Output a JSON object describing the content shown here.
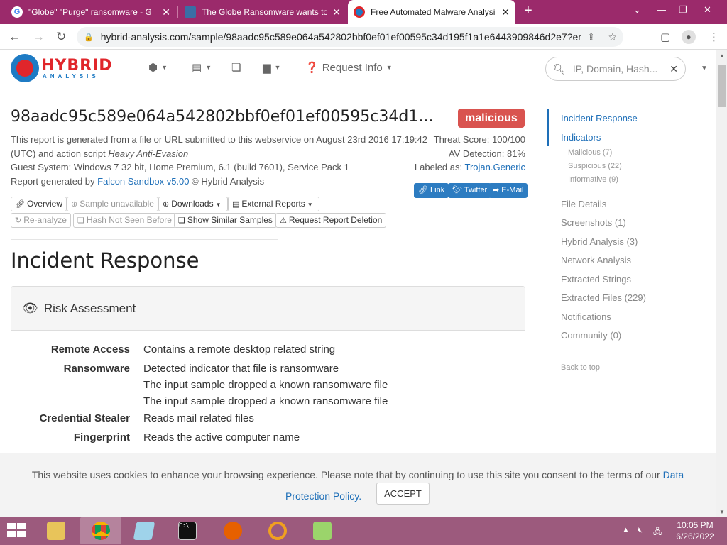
{
  "browser": {
    "tabs": [
      {
        "title": "\"Globe\" \"Purge\" ransomware - G",
        "active": false
      },
      {
        "title": "The Globe Ransomware wants to",
        "active": false
      },
      {
        "title": "Free Automated Malware Analysi",
        "active": true
      }
    ],
    "url": "hybrid-analysis.com/sample/98aadc95c589e064a542802bbf0ef01ef00595c34d195f1a1e6443909846d2e7?enviro..."
  },
  "header": {
    "logo_text": "HYBRID",
    "logo_sub": "ANALYSIS",
    "request_info": "Request Info",
    "search_placeholder": "IP, Domain, Hash..."
  },
  "report": {
    "hash": "98aadc95c589e064a542802bbf0ef01ef00595c34d1...",
    "verdict": "malicious",
    "line1": "This report is generated from a file or URL submitted to this webservice on August 23rd 2016 17:19:42",
    "line2_prefix": "(UTC) and action script ",
    "line2_script": "Heavy Anti-Evasion",
    "line3": "Guest System: Windows 7 32 bit, Home Premium, 6.1 (build 7601), Service Pack 1",
    "line4_prefix": "Report generated by ",
    "line4_link": "Falcon Sandbox v5.00",
    "line4_suffix": " © Hybrid Analysis",
    "threat_score": "Threat Score: 100/100",
    "av_detection": "AV Detection: 81%",
    "labeled_prefix": "Labeled as: ",
    "labeled_link": "Trojan.Generic"
  },
  "share": {
    "link": "Link",
    "twitter": "Twitter",
    "email": "E-Mail"
  },
  "actions": {
    "overview": "Overview",
    "sample_unavailable": "Sample unavailable",
    "downloads": "Downloads",
    "external_reports": "External Reports",
    "reanalyze": "Re-analyze",
    "hash_not_seen": "Hash Not Seen Before",
    "similar_samples": "Show Similar Samples",
    "request_deletion": "Request Report Deletion"
  },
  "section_title": "Incident Response",
  "risk": {
    "title": "Risk Assessment",
    "rows": [
      {
        "category": "Remote Access",
        "items": [
          "Contains a remote desktop related string"
        ]
      },
      {
        "category": "Ransomware",
        "items": [
          "Detected indicator that file is ransomware",
          "The input sample dropped a known ransomware file",
          "The input sample dropped a known ransomware file"
        ]
      },
      {
        "category": "Credential Stealer",
        "items": [
          "Reads mail related files"
        ]
      },
      {
        "category": "Fingerprint",
        "items": [
          "Reads the active computer name"
        ]
      }
    ]
  },
  "sidebar": {
    "incident_response": "Incident Response",
    "indicators": "Indicators",
    "malicious": "Malicious (7)",
    "suspicious": "Suspicious (22)",
    "informative": "Informative (9)",
    "file_details": "File Details",
    "screenshots": "Screenshots (1)",
    "hybrid_analysis": "Hybrid Analysis (3)",
    "network_analysis": "Network Analysis",
    "extracted_strings": "Extracted Strings",
    "extracted_files": "Extracted Files (229)",
    "notifications": "Notifications",
    "community": "Community (0)",
    "back_to_top": "Back to top"
  },
  "cookie": {
    "text": "This website uses cookies to enhance your browsing experience. Please note that by continuing to use this site you consent to the terms of our",
    "link1": "Data",
    "link2": "Protection Policy.",
    "accept": "ACCEPT"
  },
  "taskbar": {
    "time": "10:05 PM",
    "date": "6/26/2022"
  },
  "colors": {
    "tabstrip": "#9b2a6b",
    "taskbar": "#9c5a7d",
    "verdict": "#d9534f",
    "link": "#1e6fb8"
  }
}
